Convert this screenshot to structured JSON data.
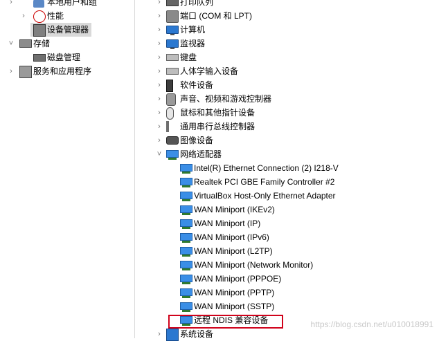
{
  "left_tree": [
    {
      "label": "本地用户和组",
      "icon": "users-icon",
      "chev": "›",
      "selected": false
    },
    {
      "label": "性能",
      "icon": "performance-icon",
      "chev": "›",
      "selected": false
    },
    {
      "label": "设备管理器",
      "icon": "device-manager-icon",
      "chev": "",
      "selected": true
    },
    {
      "label": "存储",
      "icon": "storage-icon",
      "chev": "˅",
      "selected": false
    },
    {
      "label": "磁盘管理",
      "icon": "disk-management-icon",
      "chev": "",
      "selected": false
    },
    {
      "label": "服务和应用程序",
      "icon": "services-icon",
      "chev": "›",
      "selected": false
    }
  ],
  "right_tree": [
    {
      "label": "打印队列",
      "icon": "printer-icon",
      "chev": "›"
    },
    {
      "label": "端口 (COM 和 LPT)",
      "icon": "port-icon",
      "chev": "›"
    },
    {
      "label": "计算机",
      "icon": "computer-icon",
      "chev": "›"
    },
    {
      "label": "监视器",
      "icon": "monitor-icon",
      "chev": "›"
    },
    {
      "label": "键盘",
      "icon": "keyboard-icon",
      "chev": "›"
    },
    {
      "label": "人体学输入设备",
      "icon": "hid-icon",
      "chev": "›"
    },
    {
      "label": "软件设备",
      "icon": "software-device-icon",
      "chev": "›"
    },
    {
      "label": "声音、视频和游戏控制器",
      "icon": "sound-icon",
      "chev": "›"
    },
    {
      "label": "鼠标和其他指针设备",
      "icon": "mouse-icon",
      "chev": "›"
    },
    {
      "label": "通用串行总线控制器",
      "icon": "usb-icon",
      "chev": "›"
    },
    {
      "label": "图像设备",
      "icon": "camera-icon",
      "chev": "›"
    },
    {
      "label": "网络适配器",
      "icon": "network-adapter-icon",
      "chev": "˅"
    },
    {
      "label": "Intel(R) Ethernet Connection (2) I218-V",
      "icon": "network-card-icon",
      "chev": ""
    },
    {
      "label": "Realtek PCI GBE Family Controller #2",
      "icon": "network-card-icon",
      "chev": ""
    },
    {
      "label": "VirtualBox Host-Only Ethernet Adapter",
      "icon": "network-card-icon",
      "chev": ""
    },
    {
      "label": "WAN Miniport (IKEv2)",
      "icon": "network-card-icon",
      "chev": ""
    },
    {
      "label": "WAN Miniport (IP)",
      "icon": "network-card-icon",
      "chev": ""
    },
    {
      "label": "WAN Miniport (IPv6)",
      "icon": "network-card-icon",
      "chev": ""
    },
    {
      "label": "WAN Miniport (L2TP)",
      "icon": "network-card-icon",
      "chev": ""
    },
    {
      "label": "WAN Miniport (Network Monitor)",
      "icon": "network-card-icon",
      "chev": ""
    },
    {
      "label": "WAN Miniport (PPPOE)",
      "icon": "network-card-icon",
      "chev": ""
    },
    {
      "label": "WAN Miniport (PPTP)",
      "icon": "network-card-icon",
      "chev": ""
    },
    {
      "label": "WAN Miniport (SSTP)",
      "icon": "network-card-icon",
      "chev": ""
    },
    {
      "label": "远程 NDIS 兼容设备",
      "icon": "network-card-icon",
      "chev": ""
    },
    {
      "label": "系统设备",
      "icon": "system-device-icon",
      "chev": "›"
    }
  ],
  "watermark": "https://blog.csdn.net/u010018991",
  "colors": {
    "highlight_border": "#d0021b",
    "selected_bg": "#d9d9d9"
  }
}
